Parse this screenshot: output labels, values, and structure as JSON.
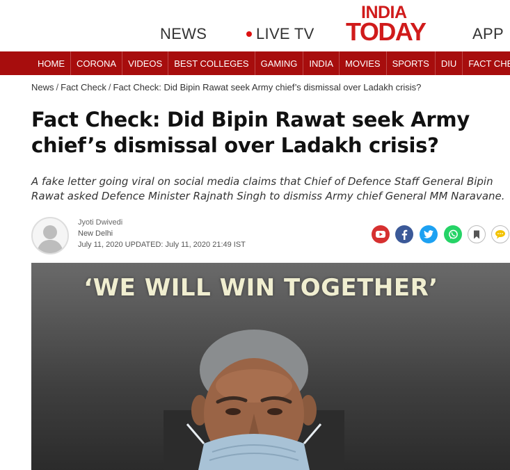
{
  "header": {
    "links": {
      "news": "NEWS",
      "live_tv": "LIVE TV",
      "app": "APP"
    },
    "logo": {
      "line1": "INDIA",
      "line2": "TODAY"
    },
    "brand_color": "#d01b1b"
  },
  "nav": {
    "bg_color": "#a70d0d",
    "items": [
      "HOME",
      "CORONA",
      "VIDEOS",
      "BEST COLLEGES",
      "GAMING",
      "INDIA",
      "MOVIES",
      "SPORTS",
      "DIU",
      "FACT CHECK"
    ]
  },
  "breadcrumb": {
    "items": [
      "News",
      "Fact Check",
      "Fact Check: Did Bipin Rawat seek Army chief’s dismissal over Ladakh crisis?"
    ],
    "separator": "/"
  },
  "article": {
    "title": "Fact Check: Did Bipin Rawat seek Army chief’s dismissal over Ladakh crisis?",
    "summary": "A fake letter going viral on social media claims that Chief of Defence Staff General Bipin Rawat asked Defence Minister Rajnath Singh to dismiss Army chief General MM Naravane.",
    "author": {
      "name": "Jyoti Dwivedi",
      "location": "New Delhi",
      "date_line": "July 11, 2020 UPDATED: July 11, 2020 21:49 IST"
    },
    "share": {
      "youtube_icon": "youtube-icon",
      "facebook_icon": "facebook-icon",
      "twitter_icon": "twitter-icon",
      "whatsapp_icon": "whatsapp-icon",
      "bookmark_icon": "bookmark-icon",
      "comment_icon": "comment-icon"
    },
    "hero": {
      "caption": "‘WE WILL WIN TOGETHER’"
    }
  }
}
